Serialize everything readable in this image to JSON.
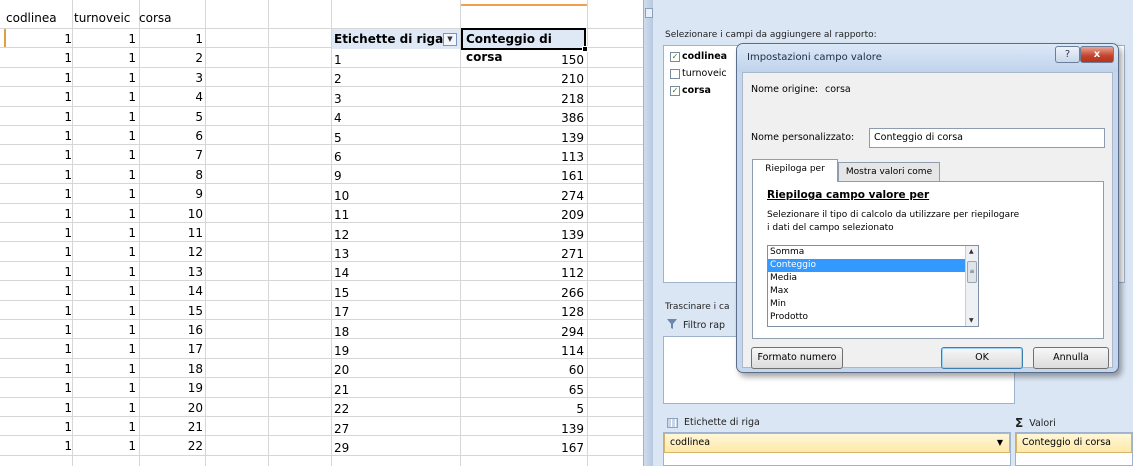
{
  "spreadsheet": {
    "col_headers": [
      "codlinea",
      "turnoveic",
      "corsa"
    ],
    "rows": [
      [
        "1",
        "1",
        "1"
      ],
      [
        "1",
        "1",
        "2"
      ],
      [
        "1",
        "1",
        "3"
      ],
      [
        "1",
        "1",
        "4"
      ],
      [
        "1",
        "1",
        "5"
      ],
      [
        "1",
        "1",
        "6"
      ],
      [
        "1",
        "1",
        "7"
      ],
      [
        "1",
        "1",
        "8"
      ],
      [
        "1",
        "1",
        "9"
      ],
      [
        "1",
        "1",
        "10"
      ],
      [
        "1",
        "1",
        "11"
      ],
      [
        "1",
        "1",
        "12"
      ],
      [
        "1",
        "1",
        "13"
      ],
      [
        "1",
        "1",
        "14"
      ],
      [
        "1",
        "1",
        "15"
      ],
      [
        "1",
        "1",
        "16"
      ],
      [
        "1",
        "1",
        "17"
      ],
      [
        "1",
        "1",
        "18"
      ],
      [
        "1",
        "1",
        "19"
      ],
      [
        "1",
        "1",
        "20"
      ],
      [
        "1",
        "1",
        "21"
      ],
      [
        "1",
        "1",
        "22"
      ]
    ]
  },
  "pivot_table": {
    "row_label_header": "Etichette di riga",
    "value_header": "Conteggio di corsa",
    "rows": [
      [
        "1",
        "150"
      ],
      [
        "2",
        "210"
      ],
      [
        "3",
        "218"
      ],
      [
        "4",
        "386"
      ],
      [
        "5",
        "139"
      ],
      [
        "6",
        "113"
      ],
      [
        "9",
        "161"
      ],
      [
        "10",
        "274"
      ],
      [
        "11",
        "209"
      ],
      [
        "12",
        "139"
      ],
      [
        "13",
        "271"
      ],
      [
        "14",
        "112"
      ],
      [
        "15",
        "266"
      ],
      [
        "17",
        "128"
      ],
      [
        "18",
        "294"
      ],
      [
        "19",
        "114"
      ],
      [
        "20",
        "60"
      ],
      [
        "21",
        "65"
      ],
      [
        "22",
        "5"
      ],
      [
        "27",
        "139"
      ],
      [
        "29",
        "167"
      ]
    ]
  },
  "field_list": {
    "title": "Selezionare i campi da aggiungere al rapporto:",
    "fields": [
      {
        "label": "codlinea",
        "checked": true
      },
      {
        "label": "turnoveic",
        "checked": false
      },
      {
        "label": "corsa",
        "checked": true
      }
    ],
    "drag_title": "Trascinare i ca",
    "filter_label": "Filtro rap",
    "rows_zone_label": "Etichette di riga",
    "rows_zone_item": "codlinea",
    "values_zone_label": "Valori",
    "values_zone_item": "Conteggio di corsa",
    "icons": {
      "filter": "filter-icon",
      "rows": "row-labels-icon",
      "values": "sigma-icon"
    }
  },
  "dialog": {
    "title": "Impostazioni campo valore",
    "help_button": "?",
    "close_button": "x",
    "source_label": "Nome origine:",
    "source_value": "corsa",
    "custom_name_label": "Nome personalizzato:",
    "custom_name_value": "Conteggio di corsa",
    "tabs": [
      "Riepiloga per",
      "Mostra valori come"
    ],
    "active_tab": "Riepiloga per",
    "section_title": "Riepiloga campo valore per",
    "instruction_line1": "Selezionare il tipo di calcolo da utilizzare per riepilogare",
    "instruction_line2": "i dati del campo selezionato",
    "functions": [
      "Somma",
      "Conteggio",
      "Media",
      "Max",
      "Min",
      "Prodotto"
    ],
    "selected_function": "Conteggio",
    "number_format_button": "Formato numero",
    "ok_button": "OK",
    "cancel_button": "Annulla"
  },
  "colors": {
    "selection": "#3399ff",
    "pivot_header_bg": "#dfe9f6",
    "pane_bg": "#dbe6f4",
    "close_button": "#c3422b",
    "zone_item_bg": "#ffe9a8"
  }
}
